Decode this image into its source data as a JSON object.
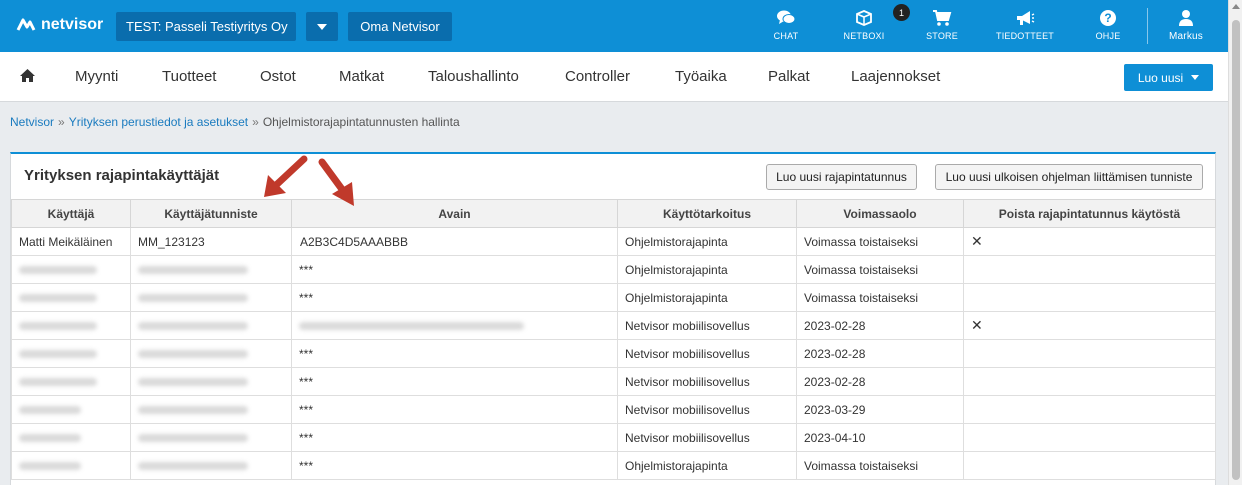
{
  "app": {
    "logo_text": "netvisor"
  },
  "header": {
    "company": "TEST: Passeli Testiyritys Oy",
    "oma": "Oma Netvisor",
    "icons": [
      {
        "label": "CHAT",
        "icon": "chat-icon"
      },
      {
        "label": "NETBOXI",
        "icon": "box-icon",
        "badge": "1"
      },
      {
        "label": "STORE",
        "icon": "cart-icon"
      },
      {
        "label": "TIEDOTTEET",
        "icon": "megaphone-icon"
      },
      {
        "label": "OHJE",
        "icon": "help-icon"
      },
      {
        "label": "Markus",
        "icon": "user-icon"
      }
    ]
  },
  "nav": {
    "items": [
      "Myynti",
      "Tuotteet",
      "Ostot",
      "Matkat",
      "Taloushallinto",
      "Controller",
      "Työaika",
      "Palkat",
      "Laajennokset"
    ],
    "create_label": "Luo uusi"
  },
  "breadcrumb": {
    "items": [
      "Netvisor",
      "Yrityksen perustiedot ja asetukset",
      "Ohjelmistorajapintatunnusten hallinta"
    ],
    "separator": "»"
  },
  "panel": {
    "title": "Yrityksen rajapintakäyttäjät",
    "btn_new_api": "Luo uusi rajapintatunnus",
    "btn_new_external": "Luo uusi ulkoisen ohjelman liittämisen tunniste"
  },
  "table": {
    "headers": [
      "Käyttäjä",
      "Käyttäjätunniste",
      "Avain",
      "Käyttötarkoitus",
      "Voimassaolo",
      "Poista rajapintatunnus käytöstä"
    ],
    "rows": [
      {
        "user": "Matti Meikäläinen",
        "user_id": "MM_123123",
        "key": "A2B3C4D5AAABBB",
        "purpose": "Ohjelmistorajapinta",
        "validity": "Voimassa toistaiseksi",
        "remove": "✕"
      },
      {
        "user": "",
        "user_id": "",
        "key": "***",
        "purpose": "Ohjelmistorajapinta",
        "validity": "Voimassa toistaiseksi",
        "remove": ""
      },
      {
        "user": "",
        "user_id": "",
        "key": "***",
        "purpose": "Ohjelmistorajapinta",
        "validity": "Voimassa toistaiseksi",
        "remove": ""
      },
      {
        "user": "",
        "user_id": "",
        "key": "",
        "purpose": "Netvisor mobiilisovellus",
        "validity": "2023-02-28",
        "remove": "✕"
      },
      {
        "user": "",
        "user_id": "",
        "key": "***",
        "purpose": "Netvisor mobiilisovellus",
        "validity": "2023-02-28",
        "remove": ""
      },
      {
        "user": "",
        "user_id": "",
        "key": "***",
        "purpose": "Netvisor mobiilisovellus",
        "validity": "2023-02-28",
        "remove": ""
      },
      {
        "user": "",
        "user_id": "",
        "key": "***",
        "purpose": "Netvisor mobiilisovellus",
        "validity": "2023-03-29",
        "remove": ""
      },
      {
        "user": "",
        "user_id": "",
        "key": "***",
        "purpose": "Netvisor mobiilisovellus",
        "validity": "2023-04-10",
        "remove": ""
      },
      {
        "user": "",
        "user_id": "",
        "key": "***",
        "purpose": "Ohjelmistorajapinta",
        "validity": "Voimassa toistaiseksi",
        "remove": ""
      }
    ]
  },
  "colors": {
    "brand": "#0e8fd6",
    "brand_dark": "#0a6dad",
    "annotation_arrow": "#c0392b"
  }
}
